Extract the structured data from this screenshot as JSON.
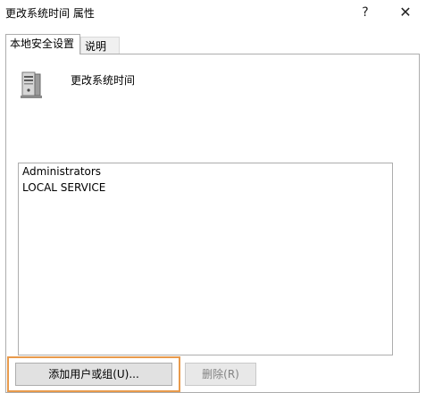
{
  "window": {
    "title": "更改系统时间 属性",
    "help_glyph": "?",
    "close_glyph": "✕"
  },
  "tabs": [
    {
      "label": "本地安全设置",
      "active": true
    },
    {
      "label": "说明",
      "active": false
    }
  ],
  "policy": {
    "name": "更改系统时间",
    "icon": "computer-tower-icon"
  },
  "members": [
    "Administrators",
    "LOCAL SERVICE"
  ],
  "buttons": {
    "add_label": "添加用户或组(U)...",
    "remove_label": "删除(R)",
    "remove_enabled": false
  },
  "colors": {
    "highlight_border": "#e89a4c"
  }
}
